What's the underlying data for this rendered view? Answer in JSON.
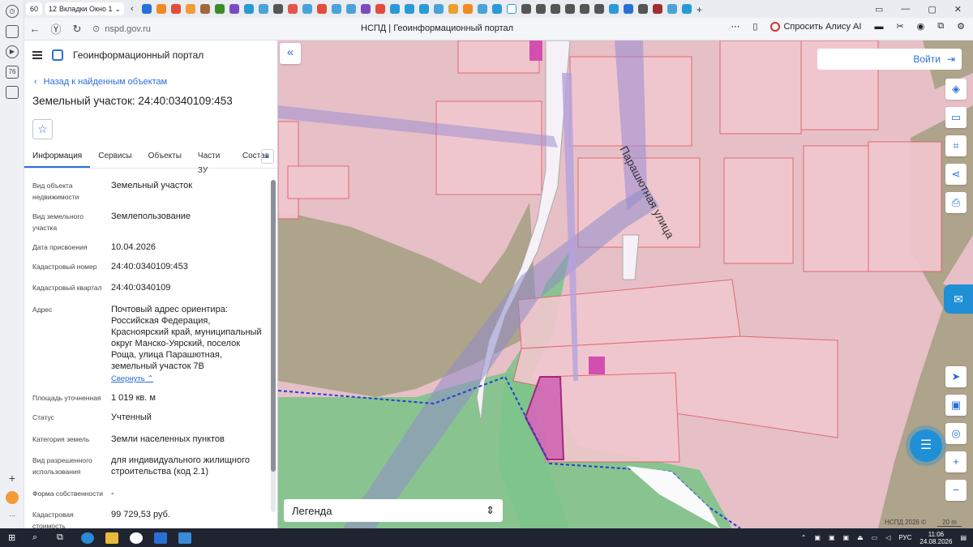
{
  "browser": {
    "tab_count": "60",
    "tab_group_count": "12",
    "tab_group_label": "Вкладки Окно 1",
    "url": "nspd.gov.ru",
    "page_title": "НСПД | Геоинформационный портал",
    "alice_label": "Спросить Алису AI"
  },
  "panel": {
    "portal_name": "Геоинформационный портал",
    "back_label": "Назад к найденным объектам",
    "object_title": "Земельный участок: 24:40:0340109:453",
    "tabs": [
      {
        "label": "Информация",
        "active": true
      },
      {
        "label": "Сервисы",
        "active": false
      },
      {
        "label": "Объекты",
        "active": false
      },
      {
        "label": "Части ЗУ",
        "active": false
      },
      {
        "label": "Состав",
        "active": false
      }
    ],
    "props": [
      {
        "label": "Вид объекта недвижимости",
        "value": "Земельный участок"
      },
      {
        "label": "Вид земельного участка",
        "value": "Землепользование"
      },
      {
        "label": "Дата присвоения",
        "value": "10.04.2026"
      },
      {
        "label": "Кадастровый номер",
        "value": "24:40:0340109:453"
      },
      {
        "label": "Кадастровый квартал",
        "value": "24:40:0340109"
      },
      {
        "label": "Адрес",
        "value": "Почтовый адрес ориентира: Российская Федерация, Красноярский край, муниципальный округ Манско-Уярский, поселок Роща, улица Парашютная, земельный участок 7В"
      },
      {
        "label": "Площадь уточненная",
        "value": "1 019 кв. м"
      },
      {
        "label": "Статус",
        "value": "Учтенный"
      },
      {
        "label": "Категория земель",
        "value": "Земли населенных пунктов"
      },
      {
        "label": "Вид разрешенного использования",
        "value": "для индивидуального жилищного строительства (код 2.1)"
      },
      {
        "label": "Форма собственности",
        "value": "-"
      },
      {
        "label": "Кадастровая стоимость",
        "value": "99 729,53 руб."
      }
    ],
    "collapse_label": "Свернуть"
  },
  "map": {
    "login_label": "Войти",
    "street_label": "Парашютная улица",
    "legend_label": "Легенда",
    "copyright": "НСПД 2026 ©",
    "scale_label": "20 m"
  },
  "taskbar": {
    "lang": "РУС",
    "time": "11:06",
    "date": "24.08.2026"
  },
  "colors": {
    "accent": "#2a6fd6",
    "parcel_pink": "#f2c7cf",
    "green": "#7ec48a",
    "olive": "#9c9a78",
    "zone_purple": "#9f8fd0"
  }
}
